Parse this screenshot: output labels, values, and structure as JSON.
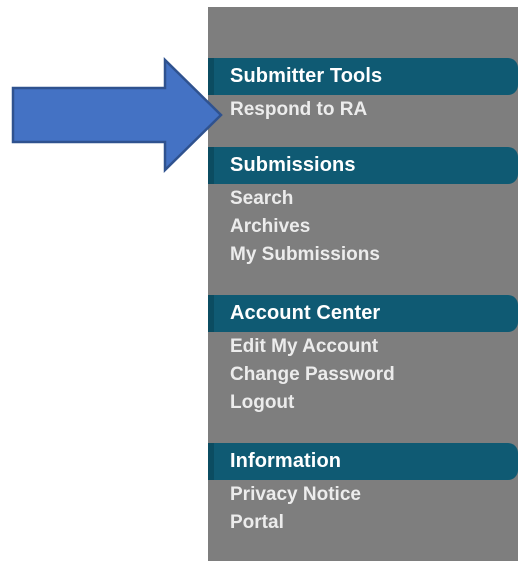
{
  "sidebar": {
    "sections": [
      {
        "title": "Submitter Tools",
        "items": [
          "Respond to RA"
        ]
      },
      {
        "title": "Submissions",
        "items": [
          "Search",
          "Archives",
          "My Submissions"
        ]
      },
      {
        "title": "Account Center",
        "items": [
          "Edit My Account",
          "Change Password",
          "Logout"
        ]
      },
      {
        "title": "Information",
        "items": [
          "Privacy Notice",
          "Portal"
        ]
      }
    ]
  },
  "colors": {
    "sidebar_background": "#7e7e7e",
    "section_header": "#0f5a73",
    "link_text": "#ececec",
    "arrow_fill": "#4472c4",
    "arrow_outline": "#2f528f"
  },
  "annotation": {
    "icon": "right-arrow-icon"
  }
}
